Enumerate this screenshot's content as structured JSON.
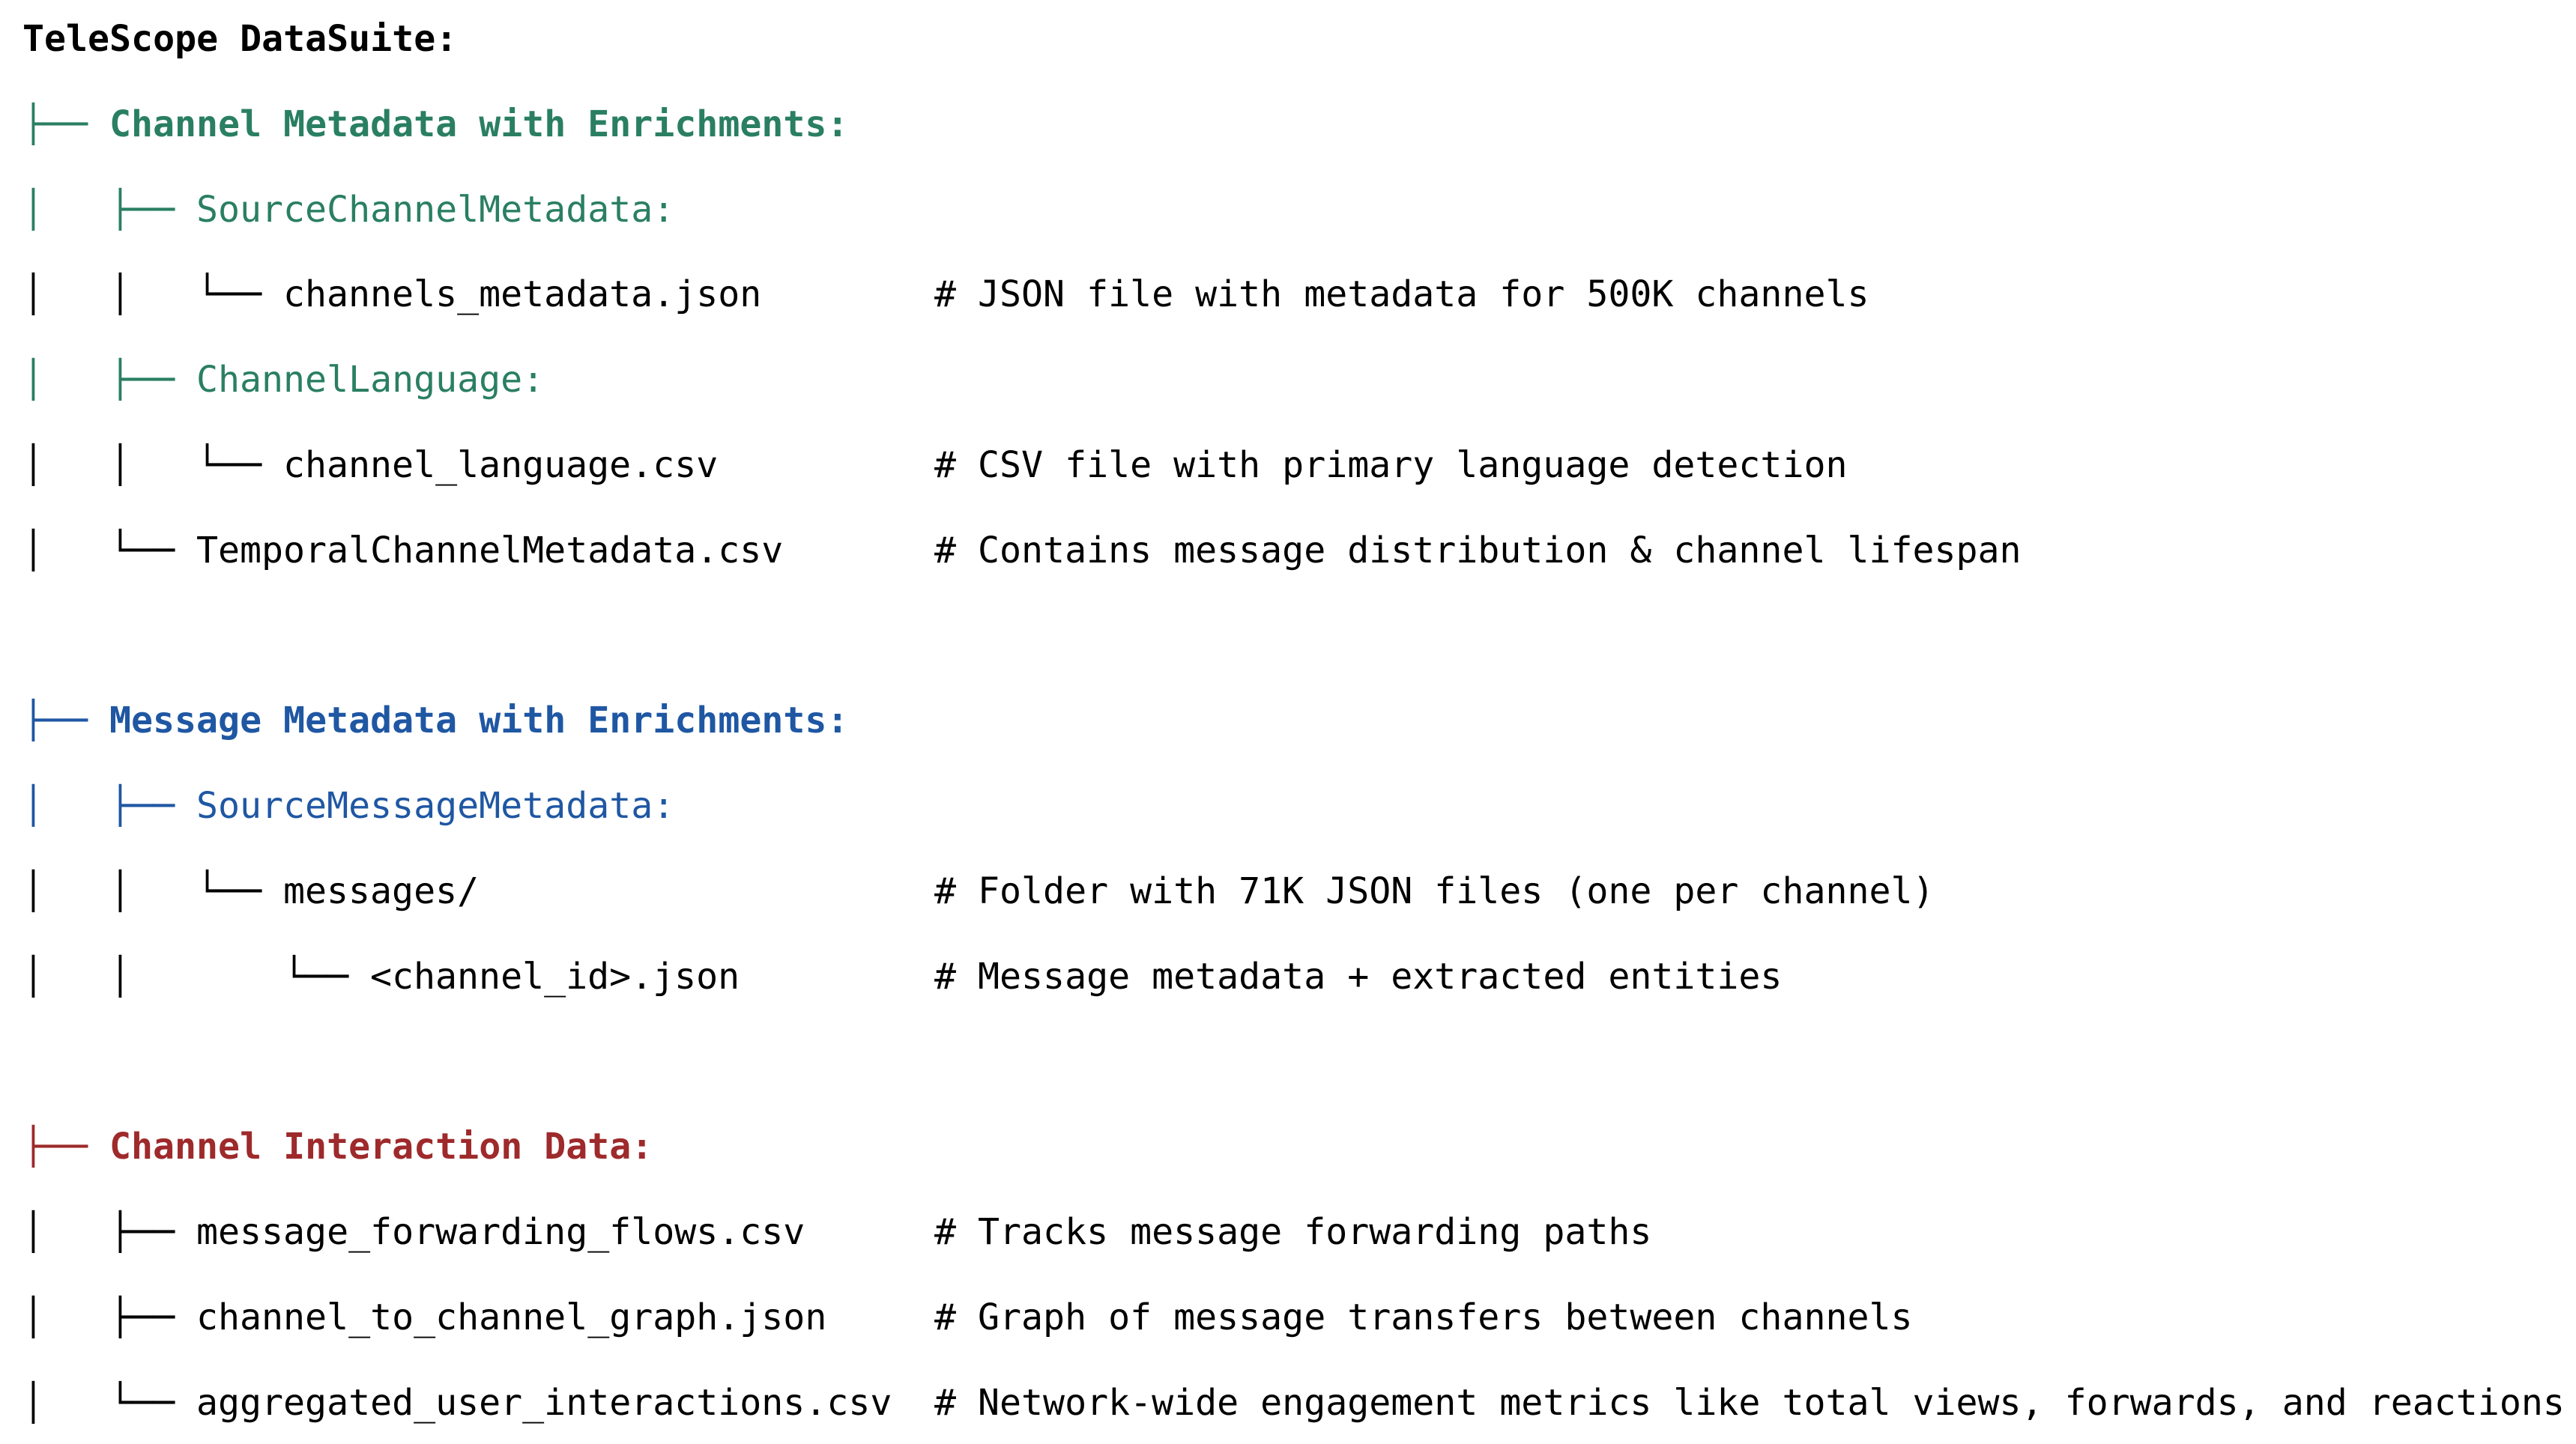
{
  "colors": {
    "default": "#000000",
    "channel_section": "#2a7f62",
    "message_section": "#1f57a3",
    "interaction_section": "#9e2a2b"
  },
  "lines": [
    {
      "prefix": "",
      "text": "TeleScope DataSuite:",
      "comment": "",
      "bold": true,
      "color": "default",
      "prefix_color": "default"
    },
    {
      "prefix": "├── ",
      "text": "Channel Metadata with Enrichments:",
      "comment": "",
      "bold": true,
      "color": "channel_section",
      "prefix_color": "channel_section"
    },
    {
      "prefix": "│   ├── ",
      "text": "SourceChannelMetadata:",
      "comment": "",
      "bold": false,
      "color": "channel_section",
      "prefix_color": "channel_section"
    },
    {
      "prefix": "│   │   └── ",
      "text": "channels_metadata.json",
      "comment": "# JSON file with metadata for 500K channels",
      "bold": false,
      "color": "default",
      "prefix_color": "default"
    },
    {
      "prefix": "│   ├── ",
      "text": "ChannelLanguage:",
      "comment": "",
      "bold": false,
      "color": "channel_section",
      "prefix_color": "channel_section"
    },
    {
      "prefix": "│   │   └── ",
      "text": "channel_language.csv",
      "comment": "# CSV file with primary language detection",
      "bold": false,
      "color": "default",
      "prefix_color": "default"
    },
    {
      "prefix": "│   └── ",
      "text": "TemporalChannelMetadata.csv",
      "comment": "# Contains message distribution & channel lifespan",
      "bold": false,
      "color": "default",
      "prefix_color": "default"
    },
    {
      "prefix": "",
      "text": "",
      "comment": "",
      "bold": false,
      "color": "default",
      "prefix_color": "default"
    },
    {
      "prefix": "├── ",
      "text": "Message Metadata with Enrichments:",
      "comment": "",
      "bold": true,
      "color": "message_section",
      "prefix_color": "message_section"
    },
    {
      "prefix": "│   ├── ",
      "text": "SourceMessageMetadata:",
      "comment": "",
      "bold": false,
      "color": "message_section",
      "prefix_color": "message_section"
    },
    {
      "prefix": "│   │   └── ",
      "text": "messages/",
      "comment": "# Folder with 71K JSON files (one per channel)",
      "bold": false,
      "color": "default",
      "prefix_color": "default"
    },
    {
      "prefix": "│   │       └── ",
      "text": "<channel_id>.json",
      "comment": "# Message metadata + extracted entities",
      "bold": false,
      "color": "default",
      "prefix_color": "default"
    },
    {
      "prefix": "",
      "text": "",
      "comment": "",
      "bold": false,
      "color": "default",
      "prefix_color": "default"
    },
    {
      "prefix": "├── ",
      "text": "Channel Interaction Data:",
      "comment": "",
      "bold": true,
      "color": "interaction_section",
      "prefix_color": "interaction_section"
    },
    {
      "prefix": "│   ├── ",
      "text": "message_forwarding_flows.csv",
      "comment": "# Tracks message forwarding paths",
      "bold": false,
      "color": "default",
      "prefix_color": "default"
    },
    {
      "prefix": "│   ├── ",
      "text": "channel_to_channel_graph.json",
      "comment": "# Graph of message transfers between channels",
      "bold": false,
      "color": "default",
      "prefix_color": "default"
    },
    {
      "prefix": "│   └── ",
      "text": "aggregated_user_interactions.csv",
      "comment": "# Network-wide engagement metrics like total views, forwards, and reactions",
      "bold": false,
      "color": "default",
      "prefix_color": "default"
    }
  ]
}
